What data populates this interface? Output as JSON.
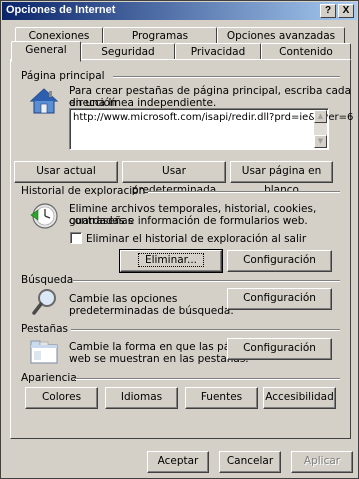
{
  "window": {
    "title": "Opciones de Internet",
    "help_label": "?",
    "close_label": "X"
  },
  "tabs_row1": [
    {
      "label": "Conexiones"
    },
    {
      "label": "Programas"
    },
    {
      "label": "Opciones avanzadas"
    }
  ],
  "tabs_row2": [
    {
      "label": "General",
      "active": true
    },
    {
      "label": "Seguridad"
    },
    {
      "label": "Privacidad"
    },
    {
      "label": "Contenido"
    }
  ],
  "home": {
    "heading": "Página principal",
    "desc_line1": "Para crear pestañas de página principal, escriba cada dirección",
    "desc_line2": "en una línea independiente.",
    "url": "http://www.microsoft.com/isapi/redir.dll?prd=ie&pver=6",
    "buttons": {
      "current": "Usar actual",
      "default": "Usar predeterminada",
      "blank": "Usar página en blanco"
    }
  },
  "history": {
    "heading": "Historial de exploración",
    "desc_line1": "Elimine archivos temporales, historial, cookies, contraseñas",
    "desc_line2": "guardadas e información de formularios web.",
    "checkbox_label": "Eliminar el historial de exploración al salir",
    "checkbox_checked": false,
    "delete_label": "Eliminar...",
    "settings_label": "Configuración"
  },
  "search": {
    "heading": "Búsqueda",
    "desc_line1": "Cambie las opciones",
    "desc_line2": "predeterminadas de búsqueda.",
    "settings_label": "Configuración"
  },
  "tabs_section": {
    "heading": "Pestañas",
    "desc_line1": "Cambie la forma en que las páginas",
    "desc_line2": "web se muestran en las pestañas.",
    "settings_label": "Configuración"
  },
  "appearance": {
    "heading": "Apariencia",
    "buttons": {
      "colors": "Colores",
      "languages": "Idiomas",
      "fonts": "Fuentes",
      "accessibility": "Accesibilidad"
    }
  },
  "footer": {
    "ok": "Aceptar",
    "cancel": "Cancelar",
    "apply": "Aplicar",
    "apply_enabled": false
  },
  "colors": {
    "titlebar_start": "#0a246a",
    "titlebar_end": "#a6caf0",
    "face": "#d4d0c8"
  }
}
